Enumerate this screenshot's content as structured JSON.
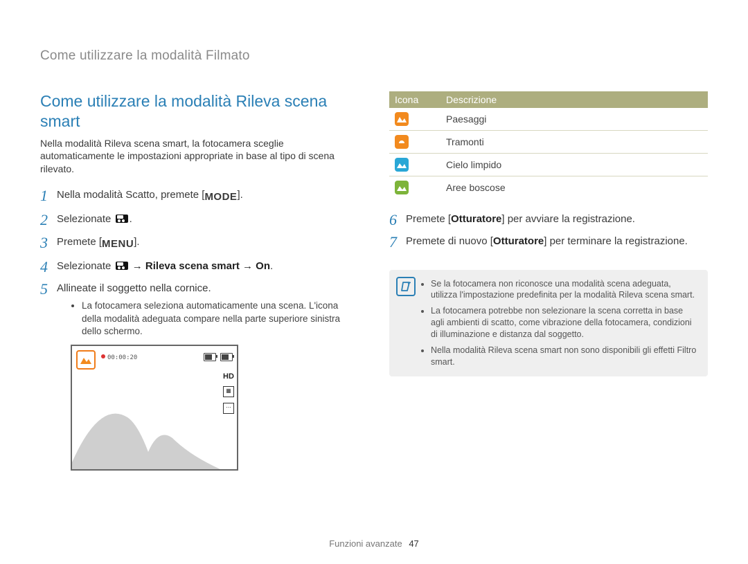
{
  "breadcrumb": "Come utilizzare la modalità Filmato",
  "title": "Come utilizzare la modalità Rileva scena smart",
  "intro": "Nella modalità Rileva scena smart, la fotocamera sceglie automaticamente le impostazioni appropriate in base al tipo di scena rilevato.",
  "steps": {
    "s1_pre": "Nella modalità Scatto, premete [",
    "s1_btn": "MODE",
    "s1_post": "].",
    "s2_pre": "Selezionate ",
    "s2_post": ".",
    "s3_pre": "Premete [",
    "s3_btn": "MENU",
    "s3_post": "].",
    "s4_pre": "Selezionate ",
    "s4_bold": " → Rileva scena smart → On",
    "s4_post": ".",
    "s5": "Allineate il soggetto nella cornice.",
    "s5_sub": "La fotocamera seleziona automaticamente una scena. L'icona della modalità adeguata compare nella parte superiore sinistra dello schermo.",
    "s6_pre": "Premete [",
    "s6_b": "Otturatore",
    "s6_post": "] per avviare la registrazione.",
    "s7_pre": "Premete di nuovo [",
    "s7_b": "Otturatore",
    "s7_post": "] per terminare la registrazione."
  },
  "preview": {
    "rec_time": "00:00:20",
    "hd_label": "HD"
  },
  "table": {
    "h1": "Icona",
    "h2": "Descrizione",
    "rows": [
      {
        "label": "Paesaggi"
      },
      {
        "label": "Tramonti"
      },
      {
        "label": "Cielo limpido"
      },
      {
        "label": "Aree boscose"
      }
    ]
  },
  "notes": [
    "Se la fotocamera non riconosce una modalità scena adeguata, utilizza l'impostazione predefinita per la modalità Rileva scena smart.",
    "La fotocamera potrebbe non selezionare la scena corretta in base agli ambienti di scatto, come vibrazione della fotocamera, condizioni di illuminazione e distanza dal soggetto.",
    "Nella modalità Rileva scena smart non sono disponibili gli effetti Filtro smart."
  ],
  "footer": {
    "section": "Funzioni avanzate",
    "page": "47"
  }
}
